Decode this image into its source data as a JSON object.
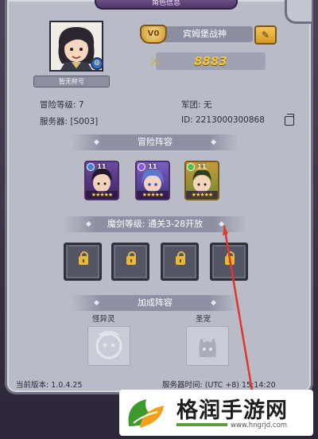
{
  "header": {
    "title": "角色信息"
  },
  "profile": {
    "title_chip": "暂无称号",
    "vip_badge": "V0",
    "player_name": "宾姆堡战神",
    "power_value": "8883",
    "adventure_level": "冒险等级: 7",
    "legion": "军团: 无",
    "server": "服务器: [S003]",
    "id": "ID: 2213000300868"
  },
  "sections": {
    "adventure_team": "冒险阵容",
    "sword_level": "魔剑等级: 通关3-28开放",
    "bonus_team": "加成阵容"
  },
  "heroes": [
    {
      "level": "11",
      "stars": "★★★★★",
      "element_color": "#3f82d8"
    },
    {
      "level": "11",
      "stars": "★★★★★",
      "element_color": "#8a5ad6"
    },
    {
      "level": "11",
      "stars": "★★★★★",
      "element_color": "#4fbf4a"
    }
  ],
  "bonus": {
    "monster_label": "怪异灵",
    "pet_label": "圣宠"
  },
  "footer": {
    "version": "当前版本: 1.0.4.25",
    "server_time": "服务器时间: (UTC +8) 15:14:20"
  },
  "watermark": {
    "title": "格润手游网",
    "url": "www.hngrjd.com"
  },
  "colors": {
    "panel": "#b9bcc7",
    "gold": "#f0c63f",
    "annotation_arrow": "#e0352b"
  }
}
